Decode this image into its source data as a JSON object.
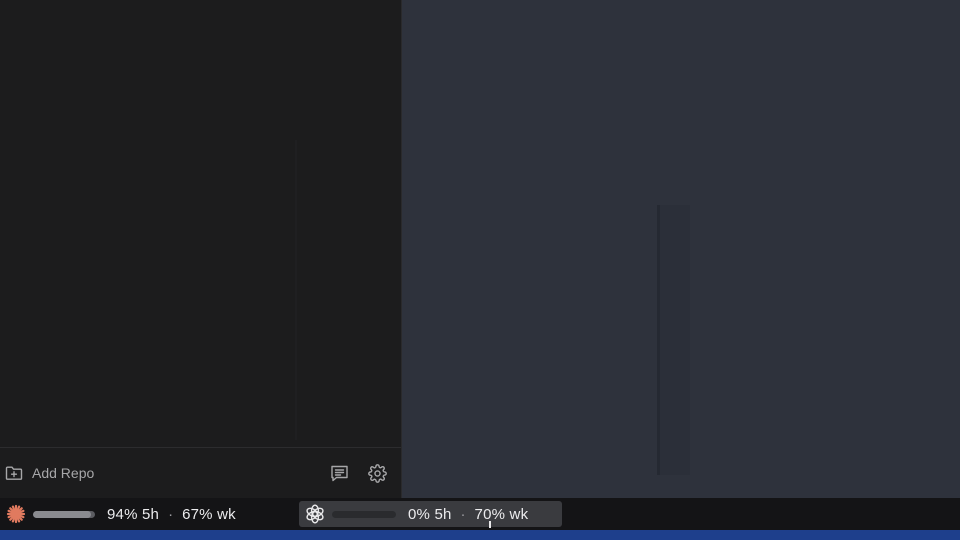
{
  "sidebar": {
    "add_repo_label": "Add Repo",
    "add_repo_icon": "folder-plus-icon",
    "feedback_icon": "message-icon",
    "settings_icon": "gear-icon"
  },
  "statusbar": {
    "claude": {
      "logo_icon": "claude-logo-icon",
      "accent_color": "#e07a5f",
      "bar_fill": 0.94,
      "session_text": "94% 5h",
      "separator": "·",
      "week_text": "67% wk"
    },
    "openai": {
      "logo_icon": "openai-logo-icon",
      "bar_fill": 0.0,
      "session_text": "0% 5h",
      "separator": "·",
      "week_text": "70% wk"
    }
  },
  "colors": {
    "sidebar_bg": "#1c1c1d",
    "main_bg": "#2e323c",
    "statusbar_bg": "#141416",
    "bottom_strip": "#1e3f8c"
  }
}
